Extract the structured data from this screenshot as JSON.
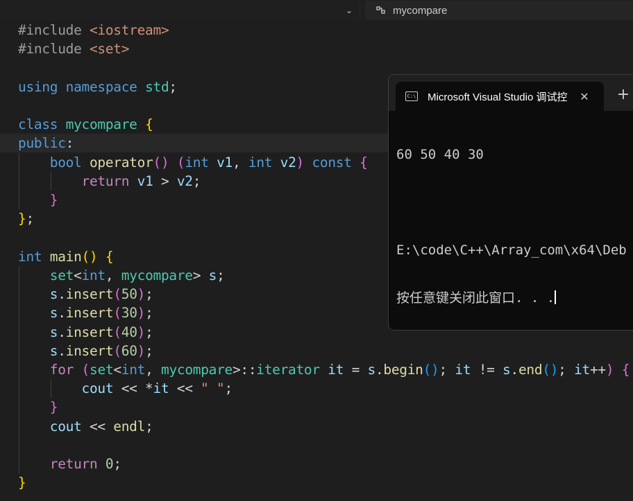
{
  "breadcrumb": {
    "symbol": "mycompare",
    "dropdown_icon": "chevron-down-icon",
    "symbol_icon": "symbol-class-icon"
  },
  "code": {
    "lines": {
      "l1": [
        [
          "t-pre",
          "#include "
        ],
        [
          "t-str",
          "<iostream>"
        ]
      ],
      "l2": [
        [
          "t-pre",
          "#include "
        ],
        [
          "t-str",
          "<set>"
        ]
      ],
      "l3": [],
      "l4": [
        [
          "t-kw",
          "using"
        ],
        [
          "t-plain",
          " "
        ],
        [
          "t-kw",
          "namespace"
        ],
        [
          "t-plain",
          " "
        ],
        [
          "t-type",
          "std"
        ],
        [
          "t-plain",
          ";"
        ]
      ],
      "l5": [],
      "l6": [
        [
          "t-kw",
          "class"
        ],
        [
          "t-plain",
          " "
        ],
        [
          "t-type",
          "mycompare"
        ],
        [
          "t-plain",
          " "
        ],
        [
          "b1",
          "{"
        ]
      ],
      "l7": [
        [
          "t-kw",
          "public"
        ],
        [
          "t-plain",
          ":"
        ]
      ],
      "l8": [
        [
          "t-plain",
          "    "
        ],
        [
          "t-kw",
          "bool"
        ],
        [
          "t-plain",
          " "
        ],
        [
          "t-fn",
          "operator"
        ],
        [
          "b2",
          "()"
        ],
        [
          "t-plain",
          " "
        ],
        [
          "b2",
          "("
        ],
        [
          "t-kw",
          "int"
        ],
        [
          "t-plain",
          " "
        ],
        [
          "t-var",
          "v1"
        ],
        [
          "t-plain",
          ", "
        ],
        [
          "t-kw",
          "int"
        ],
        [
          "t-plain",
          " "
        ],
        [
          "t-var",
          "v2"
        ],
        [
          "b2",
          ")"
        ],
        [
          "t-plain",
          " "
        ],
        [
          "t-kw",
          "const"
        ],
        [
          "t-plain",
          " "
        ],
        [
          "b2",
          "{"
        ]
      ],
      "l9": [
        [
          "t-plain",
          "        "
        ],
        [
          "t-flow",
          "return"
        ],
        [
          "t-plain",
          " "
        ],
        [
          "t-var",
          "v1"
        ],
        [
          "t-plain",
          " > "
        ],
        [
          "t-var",
          "v2"
        ],
        [
          "t-plain",
          ";"
        ]
      ],
      "l10": [
        [
          "t-plain",
          "    "
        ],
        [
          "b2",
          "}"
        ]
      ],
      "l11": [
        [
          "b1",
          "}"
        ],
        [
          "t-plain",
          ";"
        ]
      ],
      "l12": [],
      "l13": [
        [
          "t-kw",
          "int"
        ],
        [
          "t-plain",
          " "
        ],
        [
          "t-fn",
          "main"
        ],
        [
          "b1",
          "()"
        ],
        [
          "t-plain",
          " "
        ],
        [
          "b1",
          "{"
        ]
      ],
      "l14": [
        [
          "t-plain",
          "    "
        ],
        [
          "t-type",
          "set"
        ],
        [
          "t-plain",
          "<"
        ],
        [
          "t-kw",
          "int"
        ],
        [
          "t-plain",
          ", "
        ],
        [
          "t-type",
          "mycompare"
        ],
        [
          "t-plain",
          "> "
        ],
        [
          "t-var",
          "s"
        ],
        [
          "t-plain",
          ";"
        ]
      ],
      "l15": [
        [
          "t-plain",
          "    "
        ],
        [
          "t-var",
          "s"
        ],
        [
          "t-plain",
          "."
        ],
        [
          "t-fn",
          "insert"
        ],
        [
          "b2",
          "("
        ],
        [
          "t-num",
          "50"
        ],
        [
          "b2",
          ")"
        ],
        [
          "t-plain",
          ";"
        ]
      ],
      "l16": [
        [
          "t-plain",
          "    "
        ],
        [
          "t-var",
          "s"
        ],
        [
          "t-plain",
          "."
        ],
        [
          "t-fn",
          "insert"
        ],
        [
          "b2",
          "("
        ],
        [
          "t-num",
          "30"
        ],
        [
          "b2",
          ")"
        ],
        [
          "t-plain",
          ";"
        ]
      ],
      "l17": [
        [
          "t-plain",
          "    "
        ],
        [
          "t-var",
          "s"
        ],
        [
          "t-plain",
          "."
        ],
        [
          "t-fn",
          "insert"
        ],
        [
          "b2",
          "("
        ],
        [
          "t-num",
          "40"
        ],
        [
          "b2",
          ")"
        ],
        [
          "t-plain",
          ";"
        ]
      ],
      "l18": [
        [
          "t-plain",
          "    "
        ],
        [
          "t-var",
          "s"
        ],
        [
          "t-plain",
          "."
        ],
        [
          "t-fn",
          "insert"
        ],
        [
          "b2",
          "("
        ],
        [
          "t-num",
          "60"
        ],
        [
          "b2",
          ")"
        ],
        [
          "t-plain",
          ";"
        ]
      ],
      "l19": [
        [
          "t-plain",
          "    "
        ],
        [
          "t-flow",
          "for"
        ],
        [
          "t-plain",
          " "
        ],
        [
          "b2",
          "("
        ],
        [
          "t-type",
          "set"
        ],
        [
          "t-plain",
          "<"
        ],
        [
          "t-kw",
          "int"
        ],
        [
          "t-plain",
          ", "
        ],
        [
          "t-type",
          "mycompare"
        ],
        [
          "t-plain",
          ">::"
        ],
        [
          "t-type",
          "iterator"
        ],
        [
          "t-plain",
          " "
        ],
        [
          "t-var",
          "it"
        ],
        [
          "t-plain",
          " = "
        ],
        [
          "t-var",
          "s"
        ],
        [
          "t-plain",
          "."
        ],
        [
          "t-fn",
          "begin"
        ],
        [
          "b3",
          "()"
        ],
        [
          "t-plain",
          "; "
        ],
        [
          "t-var",
          "it"
        ],
        [
          "t-plain",
          " != "
        ],
        [
          "t-var",
          "s"
        ],
        [
          "t-plain",
          "."
        ],
        [
          "t-fn",
          "end"
        ],
        [
          "b3",
          "()"
        ],
        [
          "t-plain",
          "; "
        ],
        [
          "t-var",
          "it"
        ],
        [
          "t-plain",
          "++"
        ],
        [
          "b2",
          ")"
        ],
        [
          "t-plain",
          " "
        ],
        [
          "b2",
          "{"
        ]
      ],
      "l20": [
        [
          "t-plain",
          "        "
        ],
        [
          "t-var",
          "cout"
        ],
        [
          "t-plain",
          " << *"
        ],
        [
          "t-var",
          "it"
        ],
        [
          "t-plain",
          " << "
        ],
        [
          "t-str",
          "\" \""
        ],
        [
          "t-plain",
          ";"
        ]
      ],
      "l21": [
        [
          "t-plain",
          "    "
        ],
        [
          "b2",
          "}"
        ]
      ],
      "l22": [
        [
          "t-plain",
          "    "
        ],
        [
          "t-var",
          "cout"
        ],
        [
          "t-plain",
          " << "
        ],
        [
          "t-fn",
          "endl"
        ],
        [
          "t-plain",
          ";"
        ]
      ],
      "l23": [],
      "l24": [
        [
          "t-plain",
          "    "
        ],
        [
          "t-flow",
          "return"
        ],
        [
          "t-plain",
          " "
        ],
        [
          "t-num",
          "0"
        ],
        [
          "t-plain",
          ";"
        ]
      ],
      "l25": [
        [
          "b1",
          "}"
        ]
      ]
    }
  },
  "terminal": {
    "tab_icon": "console-window-icon",
    "tab_icon_text": "C:\\",
    "tab_title": "Microsoft Visual Studio 调试控",
    "close_icon": "close-icon",
    "new_tab_icon": "plus-icon",
    "new_tab_label": "+",
    "close_label": "✕",
    "output_line1": "60 50 40 30",
    "output_line2": "",
    "output_line3": "E:\\code\\C++\\Array_com\\x64\\Deb",
    "output_line4": "按任意键关闭此窗口. . ."
  }
}
